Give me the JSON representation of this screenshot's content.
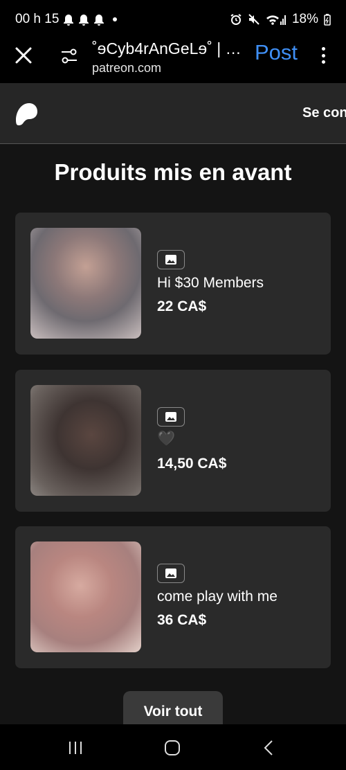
{
  "status_bar": {
    "time": "00 h 15",
    "battery": "18%"
  },
  "browser": {
    "title": "˚ɘCyb4rAnGeLɘ˚ | …",
    "url": "patreon.com",
    "post_label": "Post"
  },
  "site_header": {
    "login_label": "Se con"
  },
  "section": {
    "title": "Produits mis en avant",
    "see_all_label": "Voir tout"
  },
  "products": [
    {
      "name": "Hi $30 Members",
      "price": "22 CA$",
      "media": "image-icon"
    },
    {
      "name": "🖤",
      "price": "14,50 CA$",
      "media": "image-icon"
    },
    {
      "name": "come play with me",
      "price": "36 CA$",
      "media": "image-icon"
    }
  ],
  "colors": {
    "accent": "#3f8ff5",
    "background": "#141414",
    "card": "#2a2a2a",
    "header": "#262626"
  }
}
